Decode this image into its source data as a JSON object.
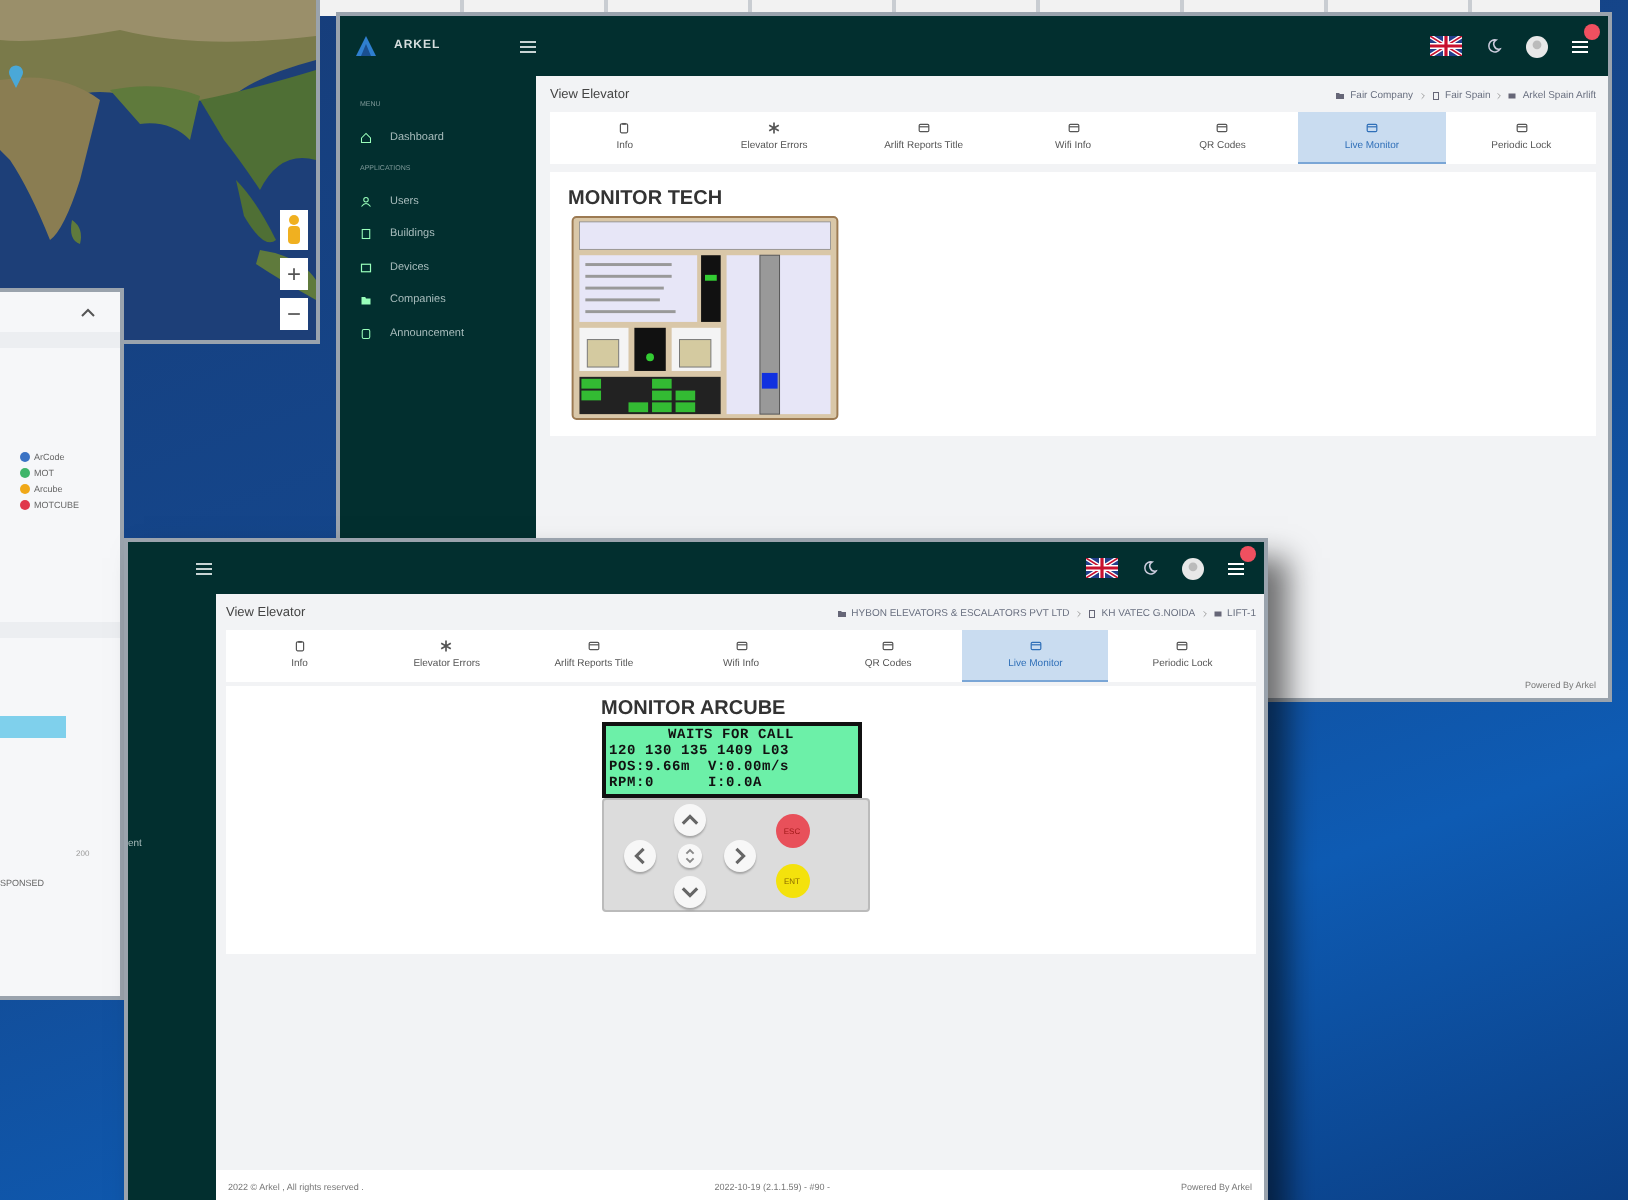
{
  "map": {
    "controls": [
      "+",
      "−"
    ]
  },
  "chart_panel": {
    "legend": [
      {
        "label": "ArCode",
        "color": "#3b73c4"
      },
      {
        "label": "MOT",
        "color": "#3fb56a"
      },
      {
        "label": "Arcube",
        "color": "#f0a818"
      },
      {
        "label": "MOTCUBE",
        "color": "#e0384c"
      }
    ],
    "tick": "200",
    "caption": "SPONSED"
  },
  "windows": [
    {
      "logo": "ARKEL",
      "sidebar": {
        "sections": [
          {
            "heading": "MENU",
            "items": [
              {
                "label": "Dashboard"
              }
            ]
          },
          {
            "heading": "APPLICATIONS",
            "items": [
              {
                "label": "Users"
              },
              {
                "label": "Buildings"
              },
              {
                "label": "Devices"
              },
              {
                "label": "Companies"
              },
              {
                "label": "Announcement"
              }
            ]
          }
        ]
      },
      "page_title": "View Elevator",
      "breadcrumb": [
        {
          "label": "Fair Company"
        },
        {
          "label": "Fair Spain"
        },
        {
          "label": "Arkel Spain Arlift"
        }
      ],
      "tabs": [
        {
          "label": "Info",
          "selected": false
        },
        {
          "label": "Elevator Errors",
          "selected": false
        },
        {
          "label": "Arlift Reports Title",
          "selected": false
        },
        {
          "label": "Wifi Info",
          "selected": false
        },
        {
          "label": "QR Codes",
          "selected": false
        },
        {
          "label": "Live Monitor",
          "selected": true
        },
        {
          "label": "Periodic Lock",
          "selected": false
        }
      ],
      "monitor": {
        "kind": "tech",
        "title": "MONITOR TECH"
      },
      "footer": {
        "right": "Powered By Arkel"
      }
    },
    {
      "sidebar_fragment": "ent",
      "page_title": "View Elevator",
      "breadcrumb": [
        {
          "label": "HYBON ELEVATORS & ESCALATORS PVT LTD"
        },
        {
          "label": "KH VATEC G.NOIDA"
        },
        {
          "label": "LIFT-1"
        }
      ],
      "tabs": [
        {
          "label": "Info",
          "selected": false
        },
        {
          "label": "Elevator Errors",
          "selected": false
        },
        {
          "label": "Arlift Reports Title",
          "selected": false
        },
        {
          "label": "Wifi Info",
          "selected": false
        },
        {
          "label": "QR Codes",
          "selected": false
        },
        {
          "label": "Live Monitor",
          "selected": true
        },
        {
          "label": "Periodic Lock",
          "selected": false
        }
      ],
      "monitor": {
        "kind": "arcube",
        "title": "MONITOR ARCUBE",
        "lcd_lines": [
          "WAITS FOR CALL",
          "120 130 135 1409 L03",
          "POS:9.66m  V:0.00m/s",
          "RPM:0      I:0.0A"
        ],
        "keys": [
          "ESC",
          "ENT"
        ]
      },
      "footer": {
        "left": "2022 © Arkel , All rights reserved .",
        "center": "2022-10-19 (2.1.1.59) - #90 -",
        "right": "Powered By Arkel"
      }
    }
  ]
}
